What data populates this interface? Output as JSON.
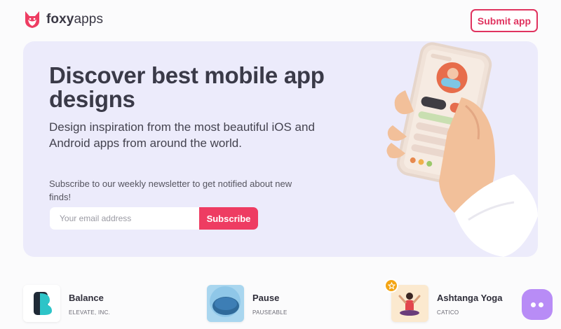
{
  "header": {
    "brand_bold": "foxy",
    "brand_light": "apps",
    "submit_label": "Submit app"
  },
  "hero": {
    "title": "Discover best mobile app designs",
    "subtitle": "Design inspiration from the most beautiful iOS and Android apps from around the world.",
    "newsletter_text": "Subscribe to our weekly newsletter to get notified about new finds!",
    "email_placeholder": "Your email address",
    "subscribe_label": "Subscribe"
  },
  "apps": [
    {
      "name": "Balance",
      "company": "ELEVATE, INC.",
      "icon": "balance-logo-icon"
    },
    {
      "name": "Pause",
      "company": "PAUSEABLE",
      "icon": "pause-logo-icon"
    },
    {
      "name": "Ashtanga Yoga",
      "company": "CATICO",
      "icon": "yoga-figure-icon",
      "featured": true
    }
  ],
  "colors": {
    "accent": "#e0335f",
    "hero_bg": "#ecebfb",
    "subscribe": "#ee3c62",
    "chat": "#b88cf6",
    "star": "#f4a514"
  }
}
